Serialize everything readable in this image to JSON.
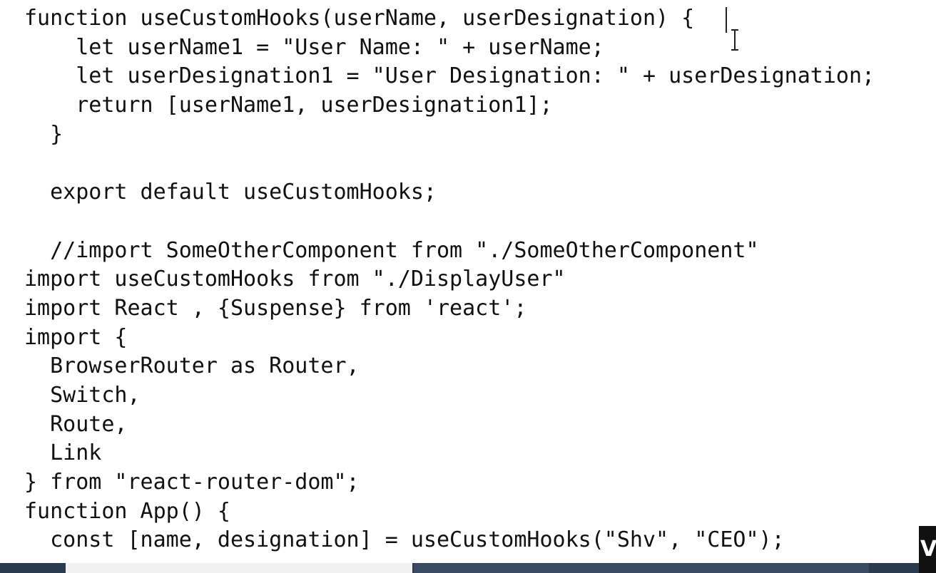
{
  "code": {
    "lines": [
      "function useCustomHooks(userName, userDesignation) {",
      "    let userName1 = \"User Name: \" + userName;",
      "    let userDesignation1 = \"User Designation: \" + userDesignation;",
      "    return [userName1, userDesignation1];",
      "  }",
      "",
      "  export default useCustomHooks;",
      "",
      "  //import SomeOtherComponent from \"./SomeOtherComponent\"",
      "import useCustomHooks from \"./DisplayUser\"",
      "import React , {Suspense} from 'react';",
      "import {",
      "  BrowserRouter as Router,",
      "  Switch,",
      "  Route,",
      "  Link",
      "} from \"react-router-dom\";",
      "function App() {",
      "  const [name, designation] = useCustomHooks(\"Shv\", \"CEO\");"
    ]
  },
  "overlay": {
    "corner_logo_letter": "V"
  },
  "colors": {
    "background": "#ffffff",
    "text": "#111111",
    "taskbar": "#2b3a4f"
  }
}
